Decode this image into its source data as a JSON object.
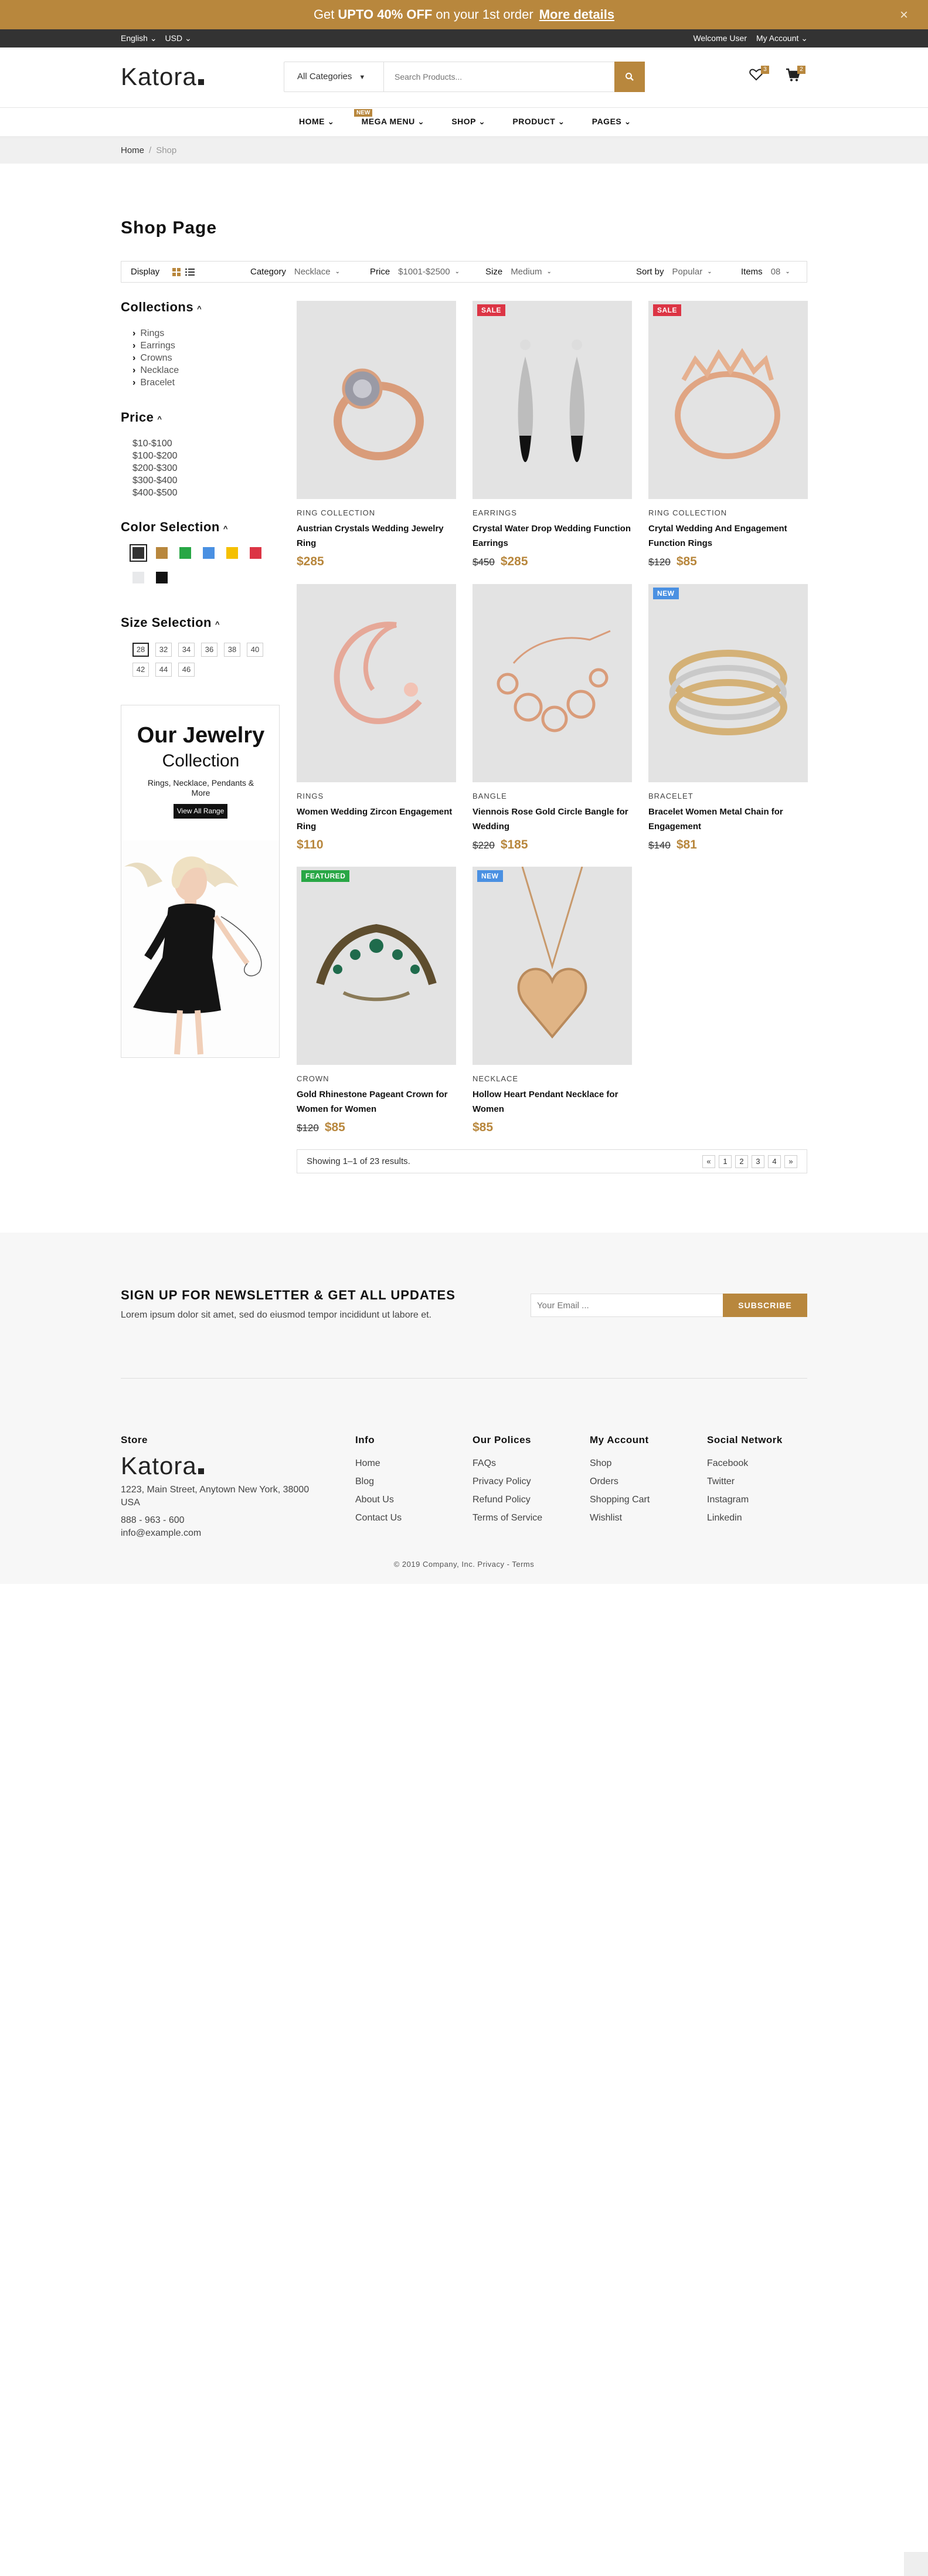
{
  "promo": {
    "pre": "Get",
    "bold": "UPTO 40% OFF",
    "post": "on your 1st order",
    "link": "More details",
    "close": "×"
  },
  "topbar": {
    "language": "English",
    "currency": "USD",
    "welcome": "Welcome User",
    "account": "My Account"
  },
  "header": {
    "logo": "Katora",
    "search_category": "All Categories",
    "search_placeholder": "Search Products...",
    "wishlist_count": "3",
    "cart_count": "2"
  },
  "nav": {
    "new_badge": "NEW",
    "items": [
      "HOME",
      "MEGA MENU",
      "SHOP",
      "PRODUCT",
      "PAGES"
    ]
  },
  "breadcrumb": {
    "home": "Home",
    "sep": "/",
    "current": "Shop"
  },
  "page_title": "Shop Page",
  "toolbar": {
    "display_label": "Display",
    "category_label": "Category",
    "category_value": "Necklace",
    "price_label": "Price",
    "price_value": "$1001-$2500",
    "size_label": "Size",
    "size_value": "Medium",
    "sort_label": "Sort by",
    "sort_value": "Popular",
    "items_label": "Items",
    "items_value": "08"
  },
  "sidebar": {
    "collections_title": "Collections",
    "collections": [
      "Rings",
      "Earrings",
      "Crowns",
      "Necklace",
      "Bracelet"
    ],
    "price_title": "Price",
    "prices": [
      "$10-$100",
      "$100-$200",
      "$200-$300",
      "$300-$400",
      "$400-$500"
    ],
    "color_title": "Color Selection",
    "colors": [
      "#333333",
      "#b8873d",
      "#28a745",
      "#4a90e2",
      "#f5c000",
      "#dc3545",
      "#e8e9eb",
      "#111111"
    ],
    "size_title": "Size Selection",
    "sizes": [
      "28",
      "32",
      "34",
      "36",
      "38",
      "40",
      "42",
      "44",
      "46"
    ]
  },
  "promo_box": {
    "title": "Our Jewelry",
    "subtitle": "Collection",
    "desc": "Rings, Necklace, Pendants & More",
    "button": "View All Range"
  },
  "products": [
    {
      "tag": "",
      "tag_color": "",
      "category": "RING COLLECTION",
      "name": "Austrian Crystals Wedding Jewelry Ring",
      "old_price": "",
      "price": "$285"
    },
    {
      "tag": "SALE",
      "tag_color": "#dc3545",
      "category": "EARRINGS",
      "name": "Crystal Water Drop Wedding Function Earrings",
      "old_price": "$450",
      "price": "$285"
    },
    {
      "tag": "SALE",
      "tag_color": "#dc3545",
      "category": "RING COLLECTION",
      "name": "Crytal Wedding And Engagement Function Rings",
      "old_price": "$120",
      "price": "$85"
    },
    {
      "tag": "",
      "tag_color": "",
      "category": "RINGS",
      "name": "Women Wedding Zircon Engagement Ring",
      "old_price": "",
      "price": "$110"
    },
    {
      "tag": "",
      "tag_color": "",
      "category": "BANGLE",
      "name": "Viennois Rose Gold Circle Bangle for Wedding",
      "old_price": "$220",
      "price": "$185"
    },
    {
      "tag": "NEW",
      "tag_color": "#4a90e2",
      "category": "BRACELET",
      "name": "Bracelet Women Metal Chain for Engagement",
      "old_price": "$140",
      "price": "$81"
    },
    {
      "tag": "FEATURED",
      "tag_color": "#28a745",
      "category": "CROWN",
      "name": "Gold Rhinestone Pageant Crown for Women for Women",
      "old_price": "$120",
      "price": "$85"
    },
    {
      "tag": "NEW",
      "tag_color": "#4a90e2",
      "category": "NECKLACE",
      "name": "Hollow Heart Pendant Necklace for Women",
      "old_price": "",
      "price": "$85"
    }
  ],
  "pager": {
    "text": "Showing 1–1 of 23 results.",
    "first": "«",
    "pages": [
      "1",
      "2",
      "3",
      "4"
    ],
    "last": "»"
  },
  "newsletter": {
    "title": "SIGN UP FOR NEWSLETTER & GET ALL UPDATES",
    "desc": "Lorem ipsum dolor sit amet, sed do eiusmod tempor incididunt ut labore et.",
    "placeholder": "Your Email ...",
    "button": "SUBSCRIBE"
  },
  "footer": {
    "store_title": "Store",
    "logo": "Katora",
    "address": "1223, Main Street, Anytown New York, 38000 USA",
    "phone": "888 - 963 - 600",
    "email": "info@example.com",
    "info_title": "Info",
    "info": [
      "Home",
      "Blog",
      "About Us",
      "Contact Us"
    ],
    "policies_title": "Our Polices",
    "policies": [
      "FAQs",
      "Privacy Policy",
      "Refund Policy",
      "Terms of Service"
    ],
    "account_title": "My Account",
    "account": [
      "Shop",
      "Orders",
      "Shopping Cart",
      "Wishlist"
    ],
    "social_title": "Social Network",
    "social": [
      "Facebook",
      "Twitter",
      "Instagram",
      "Linkedin"
    ],
    "copyright": "© 2019 Company, Inc. Privacy - Terms"
  },
  "accent": "#b8873d"
}
